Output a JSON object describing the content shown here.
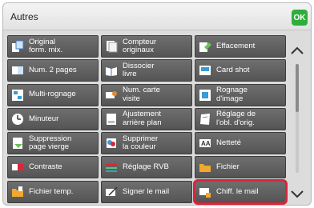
{
  "header": {
    "title": "Autres",
    "ok_label": "OK"
  },
  "accent_colors": {
    "ok": "#2eae3c",
    "highlight": "#d9263a",
    "button": "#606060"
  },
  "items": [
    {
      "label": "Original\nform. mix.",
      "icon": "mixed-size-original-icon"
    },
    {
      "label": "Compteur\noriginaux",
      "icon": "original-count-icon"
    },
    {
      "label": "Effacement",
      "icon": "erase-icon"
    },
    {
      "label": "Num. 2 pages",
      "icon": "dual-page-scan-icon"
    },
    {
      "label": "Dissocier\nlivre",
      "icon": "book-divide-icon"
    },
    {
      "label": "Card shot",
      "icon": "card-shot-icon"
    },
    {
      "label": "Multi-rognage",
      "icon": "multi-crop-icon"
    },
    {
      "label": "Num. carte\nvisite",
      "icon": "business-card-scan-icon"
    },
    {
      "label": "Rognage\nd'image",
      "icon": "image-crop-icon"
    },
    {
      "label": "Minuteur",
      "icon": "timer-icon"
    },
    {
      "label": "Ajustement\narrière plan",
      "icon": "background-adjust-icon"
    },
    {
      "label": "Réglage de\nl'obl. d'orig.",
      "icon": "skew-adjust-icon"
    },
    {
      "label": "Suppression\npage vierge",
      "icon": "blank-page-skip-icon"
    },
    {
      "label": "Supprimer\nla couleur",
      "icon": "color-drop-icon"
    },
    {
      "label": "Netteté",
      "icon": "sharpness-icon"
    },
    {
      "label": "Contraste",
      "icon": "contrast-icon"
    },
    {
      "label": "Réglage RVB",
      "icon": "rgb-adjust-icon"
    },
    {
      "label": "Fichier",
      "icon": "file-folder-icon"
    },
    {
      "label": "Fichier temp.",
      "icon": "quick-file-icon"
    },
    {
      "label": "Signer le mail",
      "icon": "sign-mail-icon"
    },
    {
      "label": "Chiff. le mail",
      "icon": "encrypt-mail-icon"
    }
  ],
  "scroll": {
    "up_icon": "chevron-up-icon",
    "down_icon": "chevron-down-icon",
    "position": 0
  }
}
